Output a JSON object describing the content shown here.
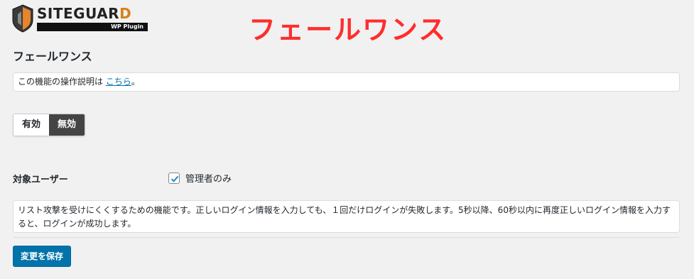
{
  "logo": {
    "brand_main": "SITEGUAR",
    "brand_last": "D",
    "subtitle": "WP Plugin"
  },
  "headline": "フェールワンス",
  "page_title": "フェールワンス",
  "notice": {
    "text": "この機能の操作説明は ",
    "link": "こちら",
    "suffix": "。"
  },
  "toggle": {
    "on_label": "有効",
    "off_label": "無効",
    "selected": "無効"
  },
  "target_users": {
    "label": "対象ユーザー",
    "option_label": "管理者のみ",
    "checked": true
  },
  "description": "リスト攻撃を受けにくくするための機能です。正しいログイン情報を入力しても、１回だけログインが失敗します。5秒以降、60秒以内に再度正しいログイン情報を入力すると、ログインが成功します。",
  "save_button": "変更を保存",
  "colors": {
    "accent": "#0073aa",
    "headline": "#ff2d2d",
    "toggle_active": "#444444"
  }
}
